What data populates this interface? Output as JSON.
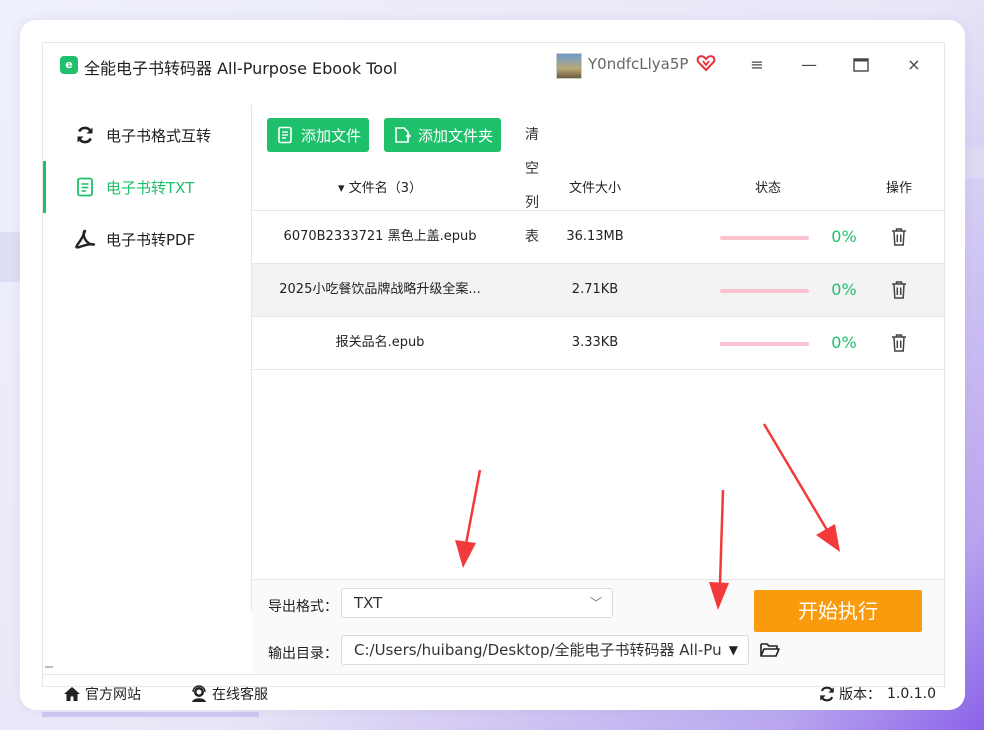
{
  "app": {
    "title": "全能电子书转码器 All-Purpose Ebook Tool",
    "logo_text": "e",
    "username": "Y0ndfcLlya5P",
    "icons": [
      "app-logo-icon",
      "vip-heart-icon",
      "menu-icon",
      "minimize-icon",
      "maximize-icon",
      "close-icon"
    ]
  },
  "window_controls": {
    "menu": "≡",
    "minimize": "—",
    "maximize": "□",
    "close": "×"
  },
  "sidebar": {
    "items": [
      {
        "label": "电子书格式互转",
        "icon": "refresh-icon",
        "active": false
      },
      {
        "label": "电子书转TXT",
        "icon": "document-icon",
        "active": true
      },
      {
        "label": "电子书转PDF",
        "icon": "pdf-icon",
        "active": false
      }
    ]
  },
  "toolbar": {
    "add_file": "添加文件",
    "add_folder": "添加文件夹",
    "clear_list": "清空列表"
  },
  "table": {
    "headers": {
      "name": "▾ 文件名（3）",
      "size": "文件大小",
      "status": "状态",
      "action": "操作"
    },
    "rows": [
      {
        "name": "6070B2333721 黑色上盖.epub",
        "size": "36.13MB",
        "progress": 0,
        "percent": "0%"
      },
      {
        "name": "2025小吃餐饮品牌战略升级全案...",
        "size": "2.71KB",
        "progress": 0,
        "percent": "0%"
      },
      {
        "name": "报关品名.epub",
        "size": "3.33KB",
        "progress": 0,
        "percent": "0%"
      }
    ]
  },
  "export": {
    "format_label": "导出格式：",
    "format_value": "TXT",
    "dir_label": "输出目录：",
    "dir_value": "C:/Users/huibang/Desktop/全能电子书转码器 All-Pu",
    "start_button": "开始执行"
  },
  "footer": {
    "website": "官方网站",
    "support": "在线客服",
    "version_label": "版本：",
    "version_value": "1.0.1.0"
  },
  "colors": {
    "accent": "#1fc06b",
    "start_button": "#fa9b0e",
    "progress_track": "#fbc3d0",
    "annotation_arrow": "#f23a3a"
  }
}
